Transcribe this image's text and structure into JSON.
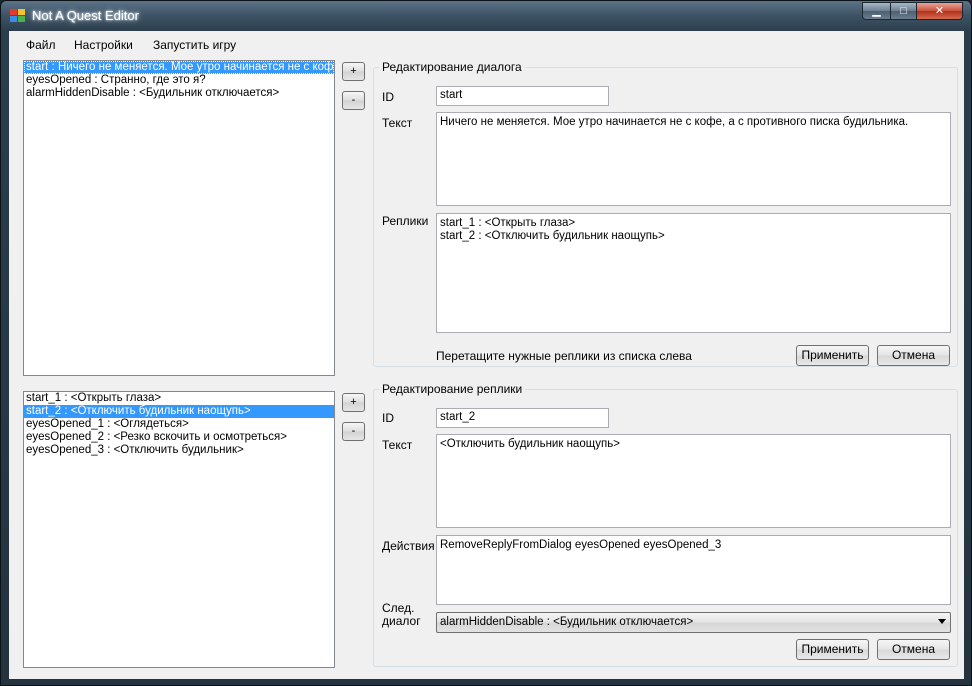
{
  "window": {
    "title": "Not A Quest Editor"
  },
  "menu": [
    "Файл",
    "Настройки",
    "Запустить игру"
  ],
  "dialogs": {
    "items": [
      "start : Ничего не меняется. Мое утро начинается не с кофе, а",
      "eyesOpened : Странно, где это я?",
      "alarmHiddenDisable : <Будильник отключается>"
    ],
    "add_label": "+",
    "remove_label": "-"
  },
  "replies": {
    "items": [
      "start_1 : <Открыть глаза>",
      "start_2 : <Отключить будильник наощупь>",
      "eyesOpened_1 : <Оглядеться>",
      "eyesOpened_2 : <Резко вскочить и осмотреться>",
      "eyesOpened_3 : <Отключить будильник>"
    ],
    "add_label": "+",
    "remove_label": "-"
  },
  "dialog_edit": {
    "title": "Редактирование диалога",
    "id_label": "ID",
    "id_value": "start",
    "text_label": "Текст",
    "text_value": "Ничего не меняется. Мое утро начинается не с кофе, а с противного писка будильника.",
    "replies_label": "Реплики",
    "replies": [
      "start_1 : <Открыть глаза>",
      "start_2 : <Отключить будильник наощупь>"
    ],
    "hint": "Перетащите нужные реплики из списка слева",
    "apply_label": "Применить",
    "cancel_label": "Отмена"
  },
  "reply_edit": {
    "title": "Редактирование реплики",
    "id_label": "ID",
    "id_value": "start_2",
    "text_label": "Текст",
    "text_value": "<Отключить будильник наощупь>",
    "actions_label": "Действия",
    "actions_value": "RemoveReplyFromDialog eyesOpened eyesOpened_3",
    "next_label_1": "След.",
    "next_label_2": "диалог",
    "next_value": "alarmHiddenDisable : <Будильник отключается>",
    "apply_label": "Применить",
    "cancel_label": "Отмена"
  }
}
